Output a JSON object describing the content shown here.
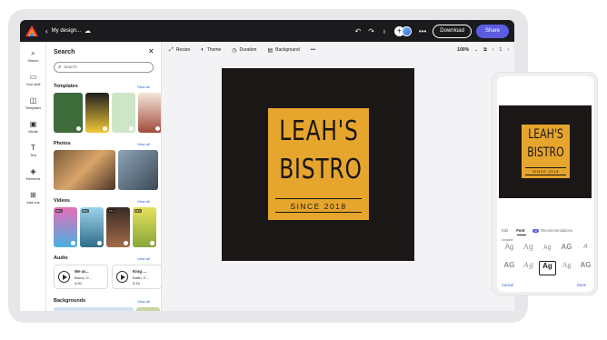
{
  "header": {
    "doc_title": "My design...",
    "download_label": "Download",
    "share_label": "Share"
  },
  "rail": {
    "items": [
      {
        "label": "Search",
        "icon": "search-icon"
      },
      {
        "label": "Your stuff",
        "icon": "folder-icon"
      },
      {
        "label": "Templates",
        "icon": "templates-icon"
      },
      {
        "label": "Media",
        "icon": "media-icon"
      },
      {
        "label": "Text",
        "icon": "text-icon"
      },
      {
        "label": "Elements",
        "icon": "elements-icon"
      },
      {
        "label": "Add-ons",
        "icon": "addons-icon"
      }
    ]
  },
  "panel": {
    "title": "Search",
    "search_placeholder": "Search",
    "view_all": "View all",
    "sections": {
      "templates": "Templates",
      "photos": "Photos",
      "videos": "Videos",
      "audio": "Audio",
      "backgrounds": "Backgrounds"
    },
    "video_durations": [
      "29 s",
      "15 s",
      "17 s",
      "19 s"
    ],
    "audio": [
      {
        "title": "We ar...",
        "artist": "Bruno, C...",
        "duration": "4:20"
      },
      {
        "title": "King ...",
        "artist": "Earth, C...",
        "duration": "3:15"
      }
    ]
  },
  "toolbar": {
    "resize": "Resize",
    "theme": "Theme",
    "duration": "Duration",
    "background": "Background",
    "more": "•••",
    "zoom": "100%",
    "page": "1"
  },
  "design": {
    "line1": "LEAH'S",
    "line2": "BISTRO",
    "since": "SINCE 2018",
    "colors": {
      "background": "#1a1716",
      "sign": "#e6a52c"
    }
  },
  "phone": {
    "tabs": [
      "Edit",
      "Font",
      "Recommendations"
    ],
    "active_tab": "Font",
    "ai_chip": "AI",
    "section_label": "Unstable",
    "cancel": "Cancel",
    "done": "Done"
  }
}
